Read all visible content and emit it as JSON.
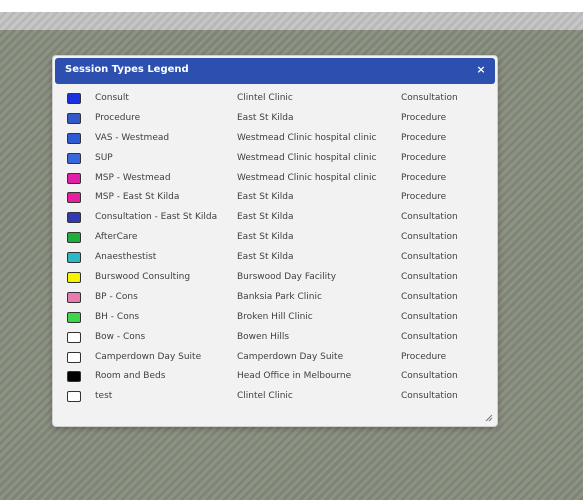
{
  "dialog": {
    "title": "Session Types Legend",
    "close_glyph": "×"
  },
  "rows": [
    {
      "name": "Consult",
      "location": "Clintel Clinic",
      "type": "Consultation",
      "color": "#1a2fe0"
    },
    {
      "name": "Procedure",
      "location": "East St Kilda",
      "type": "Procedure",
      "color": "#3458c8"
    },
    {
      "name": "VAS - Westmead",
      "location": "Westmead Clinic hospital clinic",
      "type": "Procedure",
      "color": "#2f5ad4"
    },
    {
      "name": "SUP",
      "location": "Westmead Clinic hospital clinic",
      "type": "Procedure",
      "color": "#3a66dc"
    },
    {
      "name": "MSP - Westmead",
      "location": "Westmead Clinic hospital clinic",
      "type": "Procedure",
      "color": "#e01fa6"
    },
    {
      "name": "MSP - East St Kilda",
      "location": "East St Kilda",
      "type": "Procedure",
      "color": "#e81f9c"
    },
    {
      "name": "Consultation - East St Kilda",
      "location": "East St Kilda",
      "type": "Consultation",
      "color": "#3239b5"
    },
    {
      "name": "AfterCare",
      "location": "East St Kilda",
      "type": "Consultation",
      "color": "#1fae3c"
    },
    {
      "name": "Anaesthestist",
      "location": "East St Kilda",
      "type": "Consultation",
      "color": "#2bb8c4"
    },
    {
      "name": "Burswood Consulting",
      "location": "Burswood Day Facility",
      "type": "Consultation",
      "color": "#f7f200"
    },
    {
      "name": "BP - Cons",
      "location": "Banksia Park Clinic",
      "type": "Consultation",
      "color": "#e87ab0"
    },
    {
      "name": "BH - Cons",
      "location": "Broken Hill Clinic",
      "type": "Consultation",
      "color": "#3dd64a"
    },
    {
      "name": "Bow - Cons",
      "location": "Bowen Hills",
      "type": "Consultation",
      "color": "#ffffff"
    },
    {
      "name": "Camperdown Day Suite",
      "location": "Camperdown Day Suite",
      "type": "Procedure",
      "color": "#ffffff"
    },
    {
      "name": "Room and Beds",
      "location": "Head Office in Melbourne",
      "type": "Consultation",
      "color": "#000000"
    },
    {
      "name": "test",
      "location": "Clintel Clinic",
      "type": "Consultation",
      "color": "#ffffff"
    }
  ]
}
